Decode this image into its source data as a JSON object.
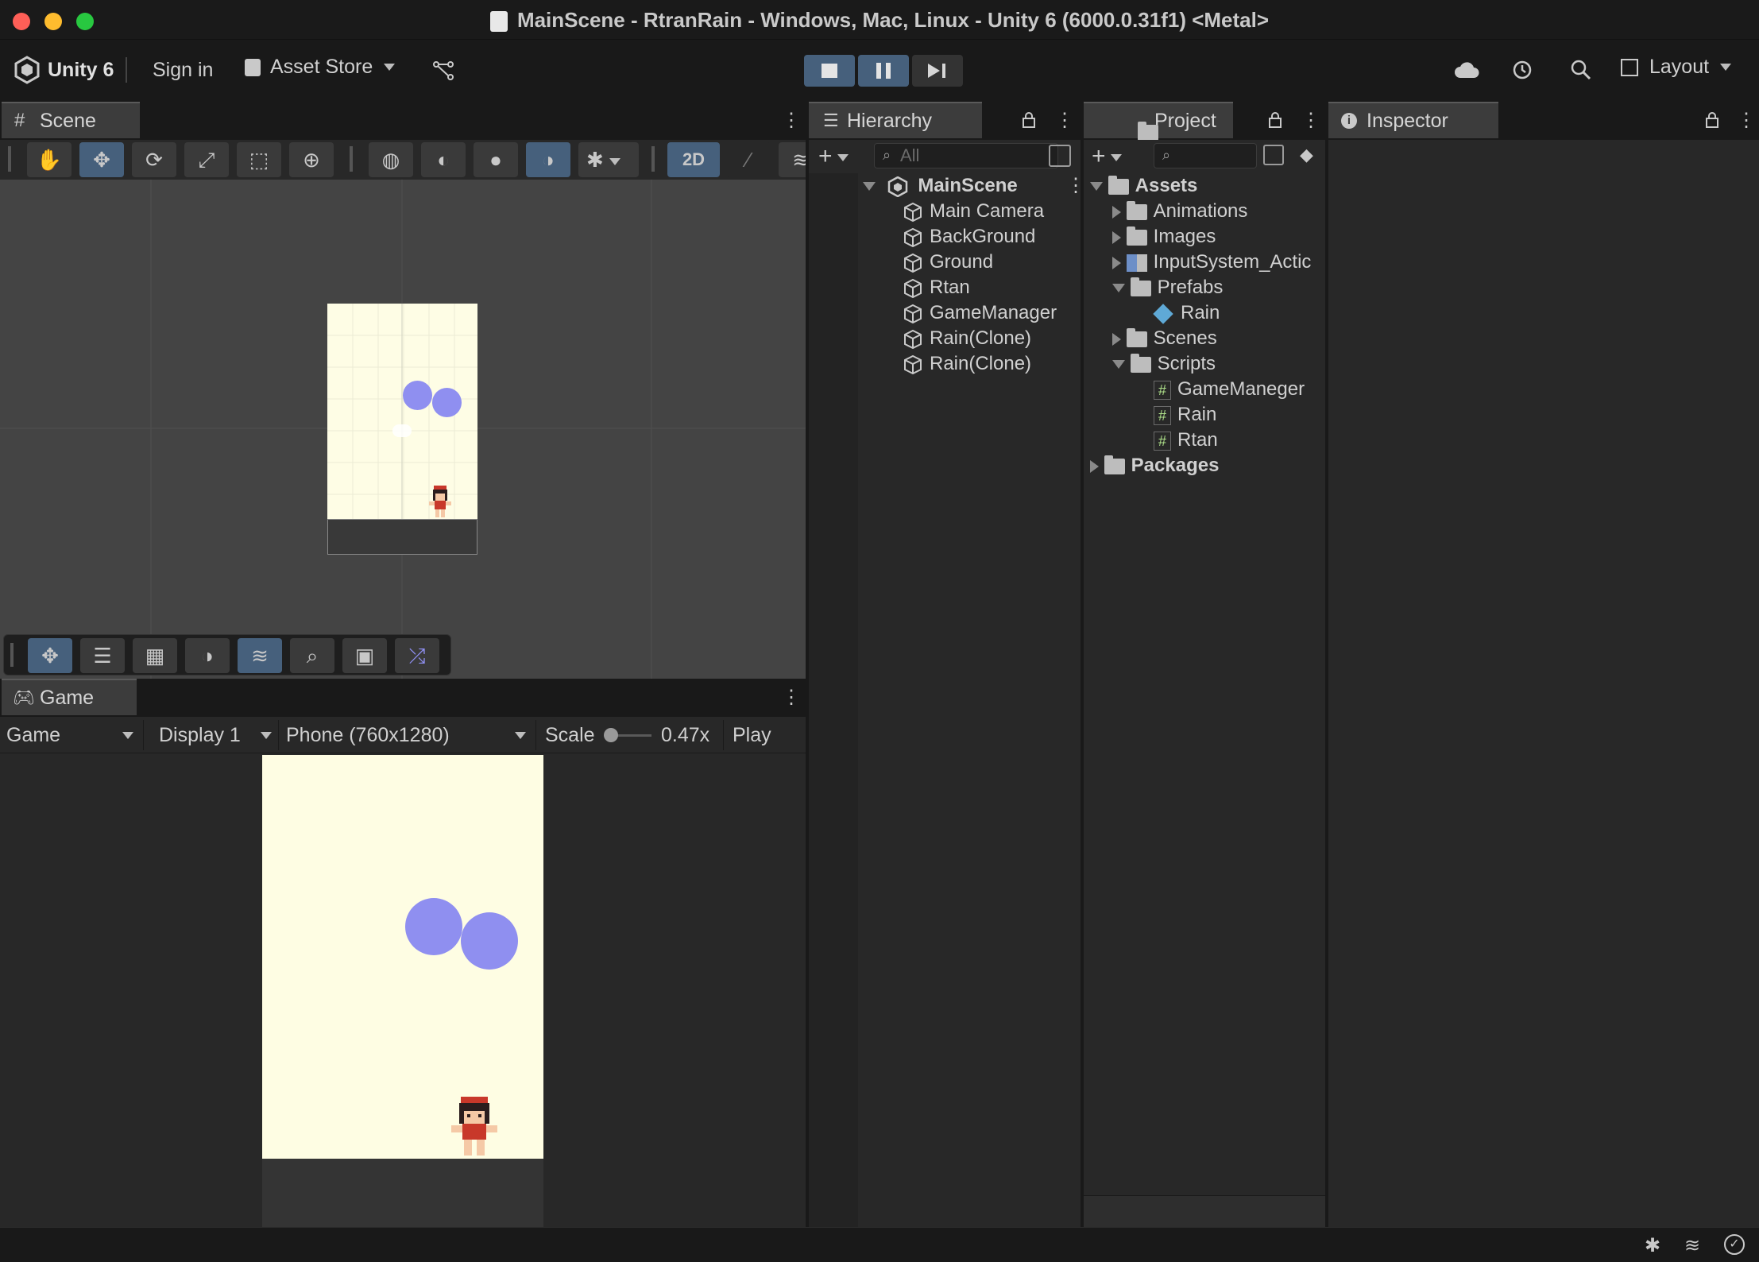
{
  "window": {
    "title": "MainScene - RtranRain - Windows, Mac, Linux - Unity 6 (6000.0.31f1) <Metal>"
  },
  "toolbar": {
    "unity_label": "Unity 6",
    "sign_in": "Sign in",
    "asset_store": "Asset Store",
    "layout": "Layout"
  },
  "scene": {
    "tab": "Scene",
    "mode_2d": "2D"
  },
  "game": {
    "tab": "Game",
    "view_select": "Game",
    "display_select": "Display 1",
    "resolution_select": "Phone (760x1280)",
    "scale_label": "Scale",
    "scale_value": "0.47x",
    "play_focused": "Play Foc"
  },
  "hierarchy": {
    "tab": "Hierarchy",
    "search_placeholder": "All",
    "scene_name": "MainScene",
    "items": [
      "Main Camera",
      "BackGround",
      "Ground",
      "Rtan",
      "GameManager",
      "Rain(Clone)",
      "Rain(Clone)"
    ]
  },
  "project": {
    "tab": "Project",
    "assets": "Assets",
    "animations": "Animations",
    "images": "Images",
    "input_actions": "InputSystem_Actic",
    "prefabs": "Prefabs",
    "prefab_rain": "Rain",
    "scenes": "Scenes",
    "scripts": "Scripts",
    "script_items": [
      "GameManeger",
      "Rain",
      "Rtan"
    ],
    "packages": "Packages"
  },
  "inspector": {
    "tab": "Inspector"
  },
  "colors": {
    "accent": "#46607c",
    "game_bg": "#fffde3",
    "rain": "#8f8ff0"
  }
}
